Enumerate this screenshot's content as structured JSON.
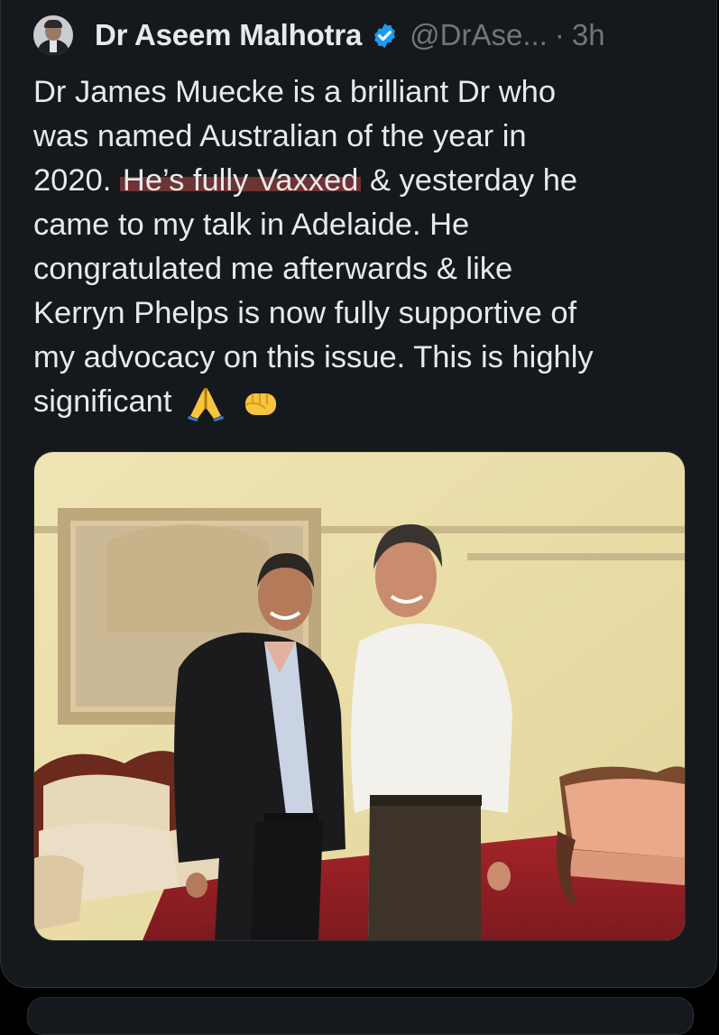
{
  "author": {
    "name": "Dr Aseem Malhotra",
    "handle": "@DrAse...",
    "separator": "·",
    "time": "3h"
  },
  "tweet": {
    "lines": [
      {
        "text": "Dr James Muecke is a brilliant Dr who"
      },
      {
        "text": "was named Australian of the year in"
      },
      {
        "before": "2020. ",
        "highlight": "He’s fully Vaxxed",
        "after": " & yesterday he"
      },
      {
        "text": "came to my talk in Adelaide. He"
      },
      {
        "text": "congratulated me afterwards & like"
      },
      {
        "text": "Kerryn Phelps is now fully supportive of"
      },
      {
        "text": "my advocacy on this issue. This is highly"
      },
      {
        "text": "significant"
      }
    ],
    "emojis": [
      "folded-hands-icon",
      "fist-icon"
    ]
  },
  "colors": {
    "background": "#15181c",
    "text": "#e7e9ea",
    "muted": "#71767b",
    "verified": "#1d9bf0",
    "highlight": "#8c3c3c"
  }
}
